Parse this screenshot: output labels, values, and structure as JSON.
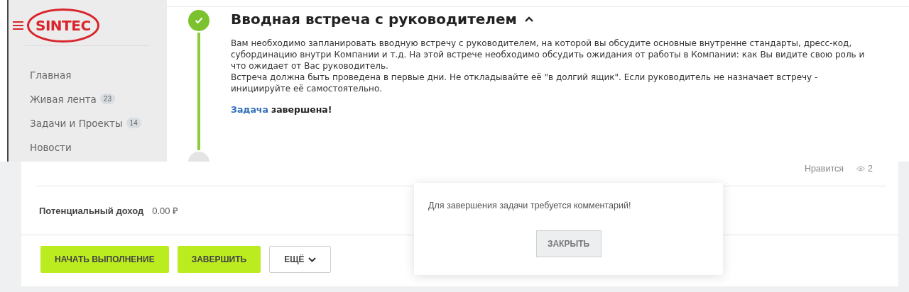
{
  "sidebar": {
    "logo": "SINTEC",
    "items": [
      {
        "label": "Главная"
      },
      {
        "label": "Живая лента",
        "count": "23"
      },
      {
        "label": "Задачи и Проекты",
        "count": "14"
      },
      {
        "label": "Новости"
      }
    ]
  },
  "task": {
    "completed": true,
    "expanded": true,
    "title": "Вводная встреча с руководителем",
    "paragraphs": [
      "Вам необходимо запланировать вводную встречу с руководителем, на которой вы обсудите основные внутренне стандарты, дресс-код, субординацию внутри Компании и т.д. На этой встрече необходимо обсудить ожидания от работы в Компании: как Вы видите свою роль и что ожидает от Вас руководитель.",
      "Встреча должна быть проведена в первые дни. Не откладывайте её \"в долгий ящик\". Если руководитель не назначает встречу - инициируйте её самостоятельно."
    ],
    "status_link": "Задача",
    "status_text": "завершена!"
  },
  "next_step": {
    "completed": false
  },
  "card": {
    "likes": "Нравится",
    "views": "2",
    "income_label": "Потенциальный доход",
    "income_value": "0.00 ₽",
    "buttons": [
      {
        "label": "НАЧАТЬ ВЫПОЛНЕНИЕ",
        "kind": "primary"
      },
      {
        "label": "ЗАВЕРШИТЬ",
        "kind": "primary"
      },
      {
        "label": "ЕЩЁ",
        "kind": "dropdown"
      }
    ]
  },
  "dialog": {
    "message": "Для завершения задачи требуется комментарий!",
    "button": "ЗАКРЫТЬ"
  }
}
